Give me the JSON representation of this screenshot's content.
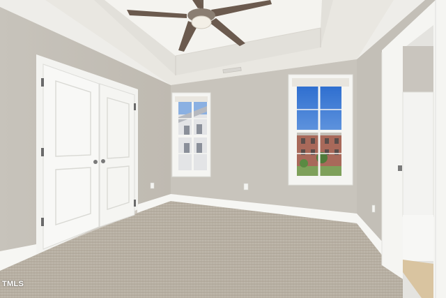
{
  "photo": {
    "watermark": "TMLS"
  },
  "colors": {
    "wall": "#c9c5bd",
    "wall_shadow": "#b9b4ab",
    "ceiling": "#f1f0ec",
    "ceiling_tray": "#e7e5df",
    "trim": "#f7f7f4",
    "carpet": "#b8b0a4",
    "sky": "#3f7fd6",
    "brick": "#a8695a",
    "fan_blade": "#6b5a4e"
  }
}
